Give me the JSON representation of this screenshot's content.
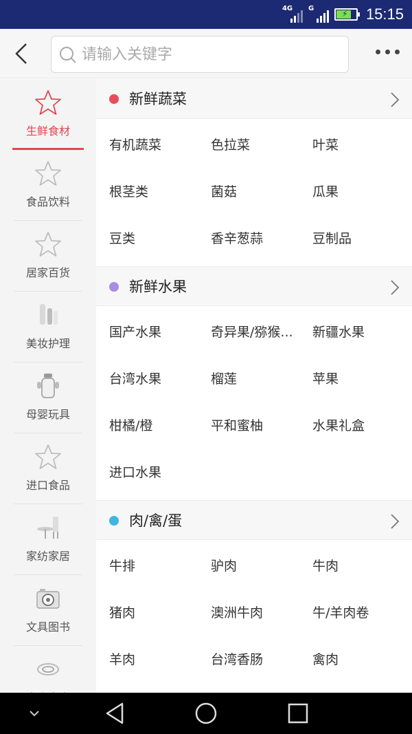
{
  "status_bar": {
    "time": "15:15",
    "network_1": "4G",
    "network_2": "G",
    "battery_fraction": 0.7
  },
  "header": {
    "search_placeholder": "请输入关键字"
  },
  "sidebar": {
    "items": [
      {
        "label": "生鲜食材",
        "icon": "star-outline-icon",
        "active": true
      },
      {
        "label": "食品饮料",
        "icon": "star-outline-icon",
        "active": false
      },
      {
        "label": "居家百货",
        "icon": "star-outline-icon",
        "active": false
      },
      {
        "label": "美妆护理",
        "icon": "cosmetics-bottles-icon",
        "active": false
      },
      {
        "label": "母婴玩具",
        "icon": "baby-bottle-icon",
        "active": false
      },
      {
        "label": "进口食品",
        "icon": "star-outline-icon",
        "active": false
      },
      {
        "label": "家纺家居",
        "icon": "furniture-icon",
        "active": false
      },
      {
        "label": "文具图书",
        "icon": "camera-icon",
        "active": false
      },
      {
        "label": "大小家电",
        "icon": "appliance-icon",
        "active": false
      }
    ]
  },
  "sections": [
    {
      "title": "新鲜蔬菜",
      "dot_color": "#e84d5b",
      "items": [
        "有机蔬菜",
        "色拉菜",
        "叶菜",
        "根茎类",
        "菌菇",
        "瓜果",
        "豆类",
        "香辛葱蒜",
        "豆制品"
      ]
    },
    {
      "title": "新鲜水果",
      "dot_color": "#a98de0",
      "items": [
        "国产水果",
        "奇异果/猕猴...",
        "新疆水果",
        "台湾水果",
        "榴莲",
        "苹果",
        "柑橘/橙",
        "平和蜜柚",
        "水果礼盒",
        "进口水果"
      ]
    },
    {
      "title": "肉/禽/蛋",
      "dot_color": "#3fb6e2",
      "items": [
        "牛排",
        "驴肉",
        "牛肉",
        "猪肉",
        "澳洲牛肉",
        "牛/羊肉卷",
        "羊肉",
        "台湾香肠",
        "禽肉"
      ]
    }
  ],
  "colors": {
    "accent": "#e24652",
    "status_bar_bg": "#1c2a73"
  }
}
